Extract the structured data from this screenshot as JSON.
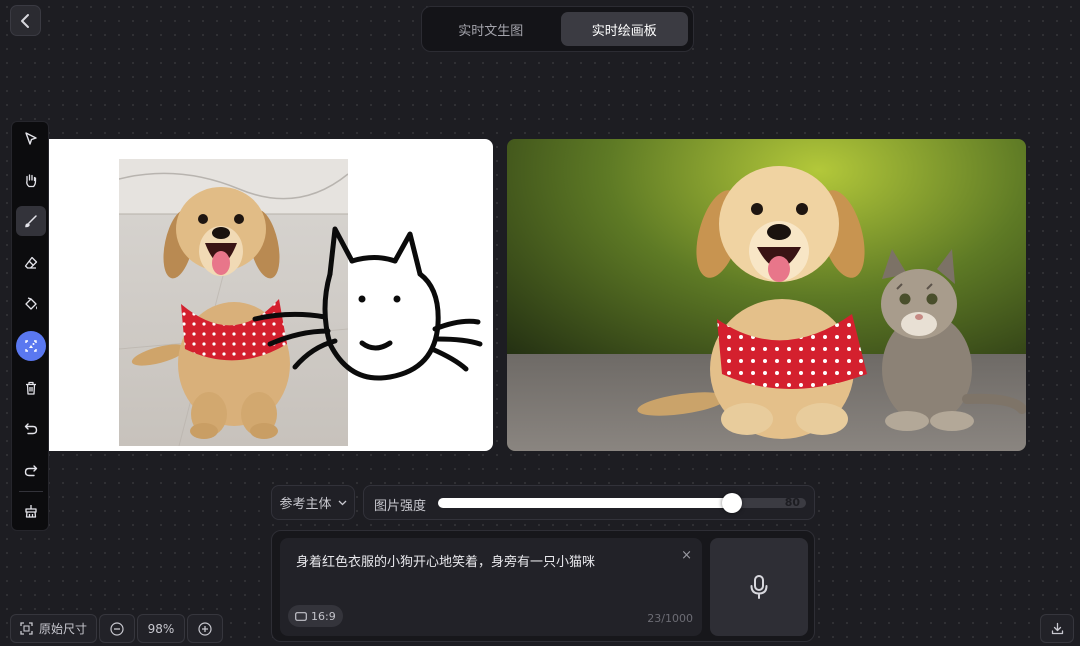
{
  "mode_tabs": [
    {
      "label": "实时文生图",
      "active": false
    },
    {
      "label": "实时绘画板",
      "active": true
    }
  ],
  "toolbar": {
    "tools": [
      "select-arrow-icon",
      "hand-icon",
      "brush-icon",
      "eraser-icon",
      "fill-bucket-icon",
      "ai-reference-icon",
      "delete-icon",
      "undo-icon",
      "redo-icon",
      "clear-icon"
    ],
    "selected_tool": "brush-icon"
  },
  "controls": {
    "subject_select": "参考主体",
    "strength_label": "图片强度",
    "strength_value": "80",
    "strength_fraction": 0.8
  },
  "prompt": {
    "text": "身着红色衣服的小狗开心地笑着，身旁有一只小猫咪",
    "clear_glyph": "×",
    "ratio": "16:9",
    "char_count": "23/1000"
  },
  "zoom": {
    "original_size_label": "原始尺寸",
    "zoom_level": "98%"
  },
  "colors": {
    "accent_blue": "#5a78f0",
    "background": "#1d1d22",
    "dog_shirt_red": "#d4202e"
  }
}
